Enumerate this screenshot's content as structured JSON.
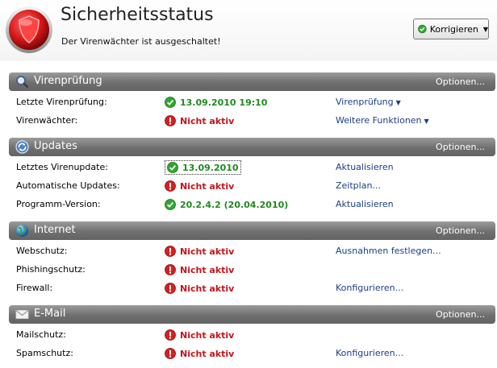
{
  "header": {
    "title": "Sicherheitsstatus",
    "subtitle": "Der Virenwächter ist ausgeschaltet!",
    "fix_button": "Korrigieren"
  },
  "colors": {
    "ok": "#1f8a1f",
    "bad": "#c4161c",
    "link": "#1a3f86",
    "section_bar": "#6f6f6f"
  },
  "sections": [
    {
      "title": "Virenprüfung",
      "icon": "magnifier-icon",
      "options": "Optionen...",
      "rows": [
        {
          "label": "Letzte Virenprüfung:",
          "status": "13.09.2010 19:10",
          "state": "ok",
          "action": "Virenprüfung",
          "dropdown": true
        },
        {
          "label": "Virenwächter:",
          "status": "Nicht aktiv",
          "state": "bad",
          "action": "Weitere Funktionen",
          "dropdown": true
        }
      ]
    },
    {
      "title": "Updates",
      "icon": "update-icon",
      "options": "Optionen...",
      "rows": [
        {
          "label": "Letztes Virenupdate:",
          "status": "13.09.2010",
          "state": "ok",
          "action": "Aktualisieren",
          "focused": true
        },
        {
          "label": "Automatische Updates:",
          "status": "Nicht aktiv",
          "state": "bad",
          "action": "Zeitplan..."
        },
        {
          "label": "Programm-Version:",
          "status": "20.2.4.2 (20.04.2010)",
          "state": "ok",
          "action": "Aktualisieren"
        }
      ]
    },
    {
      "title": "Internet",
      "icon": "globe-icon",
      "options": "Optionen...",
      "rows": [
        {
          "label": "Webschutz:",
          "status": "Nicht aktiv",
          "state": "bad",
          "action": "Ausnahmen festlegen..."
        },
        {
          "label": "Phishingschutz:",
          "status": "Nicht aktiv",
          "state": "bad",
          "action": ""
        },
        {
          "label": "Firewall:",
          "status": "Nicht aktiv",
          "state": "bad",
          "action": "Konfigurieren..."
        }
      ]
    },
    {
      "title": "E-Mail",
      "icon": "envelope-icon",
      "options": "Optionen...",
      "rows": [
        {
          "label": "Mailschutz:",
          "status": "Nicht aktiv",
          "state": "bad",
          "action": ""
        },
        {
          "label": "Spamschutz:",
          "status": "Nicht aktiv",
          "state": "bad",
          "action": "Konfigurieren..."
        }
      ]
    }
  ]
}
